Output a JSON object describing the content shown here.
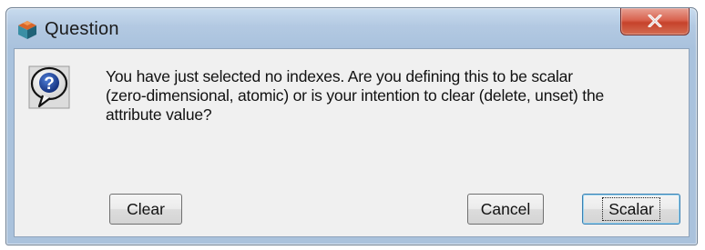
{
  "window": {
    "title": "Question",
    "icon": "app-cube-icon",
    "close_icon": "close-x-icon"
  },
  "dialog": {
    "icon": "question-mark-icon",
    "message_line1": "You have just selected no indexes.  Are you defining this to be scalar",
    "message_line2": "(zero-dimensional, atomic) or is your intention to clear (delete, unset) the",
    "message_line3": "attribute value?"
  },
  "buttons": {
    "clear_label": "Clear",
    "cancel_label": "Cancel",
    "scalar_label": "Scalar",
    "default_button": "Scalar"
  },
  "colors": {
    "title_bar": "#b3c9e2",
    "close_button": "#c6422b",
    "client_bg": "#f0f0f0"
  }
}
